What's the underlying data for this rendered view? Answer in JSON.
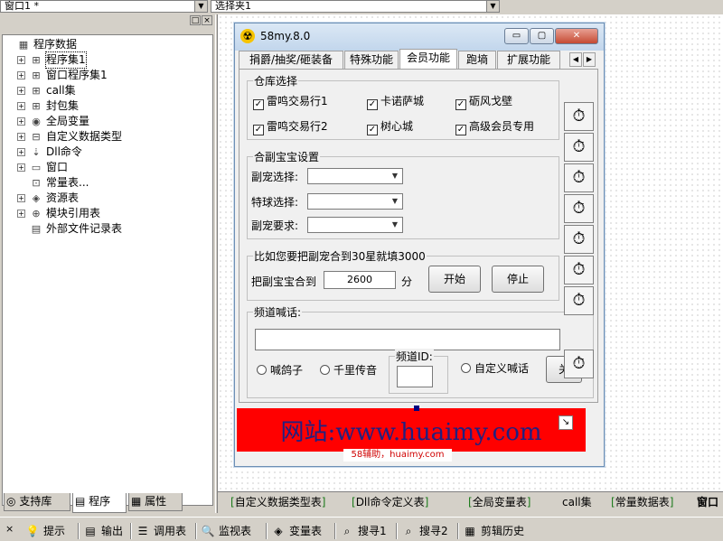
{
  "top": {
    "combo_left": "窗口1 *",
    "combo_right": "选择夹1"
  },
  "left": {
    "buttons": [
      "□",
      "×"
    ],
    "tree": [
      {
        "label": "程序数据",
        "icon": "▦",
        "icon_name": "database-icon"
      },
      {
        "label": "程序集1",
        "icon": "⊞",
        "icon_name": "module-icon",
        "expand": "+"
      },
      {
        "label": "窗口程序集1",
        "icon": "⊞",
        "icon_name": "module-icon",
        "expand": "+"
      },
      {
        "label": "call集",
        "icon": "⊞",
        "icon_name": "module-icon",
        "expand": "+"
      },
      {
        "label": "封包集",
        "icon": "⊞",
        "icon_name": "module-icon",
        "expand": "+"
      },
      {
        "label": "全局变量",
        "icon": "◉",
        "icon_name": "global-var-icon",
        "expand": "+"
      },
      {
        "label": "自定义数据类型",
        "icon": "⊟",
        "icon_name": "datatype-icon",
        "expand": "+"
      },
      {
        "label": "Dll命令",
        "icon": "⇣",
        "icon_name": "dll-icon",
        "expand": "+"
      },
      {
        "label": "窗口",
        "icon": "▭",
        "icon_name": "window-icon",
        "expand": "+"
      },
      {
        "label": "常量表...",
        "icon": "⊡",
        "icon_name": "constant-icon"
      },
      {
        "label": "资源表",
        "icon": "◈",
        "icon_name": "resource-icon",
        "expand": "+"
      },
      {
        "label": "模块引用表",
        "icon": "⊕",
        "icon_name": "module-ref-icon",
        "expand": "+"
      },
      {
        "label": "外部文件记录表",
        "icon": "▤",
        "icon_name": "file-record-icon"
      }
    ],
    "tabs": [
      {
        "label": "支持库",
        "icon": "◎"
      },
      {
        "label": "程序",
        "icon": "▤"
      },
      {
        "label": "属性",
        "icon": "▦"
      }
    ]
  },
  "form": {
    "title": "58my.8.0",
    "title_icon": "☢",
    "win_buttons": [
      "▭",
      "▢",
      "✕"
    ],
    "tabs": [
      "捐爵/抽奖/砸装备",
      "特殊功能",
      "会员功能",
      "跑墒",
      "扩展功能"
    ],
    "active_tab": 2,
    "warehouse": {
      "title": "仓库选择",
      "checks": [
        "雷鸣交易行1",
        "卡诺萨城",
        "砺风戈壁",
        "雷鸣交易行2",
        "树心城",
        "高级会员专用"
      ]
    },
    "pet": {
      "title": "合副宝宝设置",
      "rows": [
        "副宠选择:",
        "特球选择:",
        "副宠要求:"
      ]
    },
    "star": {
      "title": "比如您要把副宠合到30星就填3000",
      "label": "把副宝宝合到",
      "value": "2600",
      "unit": "分",
      "start": "开始",
      "stop": "停止"
    },
    "shout": {
      "title": "频道喊话:",
      "radio1": "喊鸽子",
      "radio2": "千里传音",
      "channel_label": "频道ID:",
      "radio3": "自定义喊话",
      "close": "关"
    },
    "timer_glyph": "⏱"
  },
  "banner": {
    "text": "网站:www.huaimy.com",
    "sub": "58辅助，huaimy.com"
  },
  "filetabs": [
    "自定义数据类型表",
    "Dll命令定义表",
    "全局变量表",
    "call集",
    "常量数据表",
    "窗口"
  ],
  "bottom": [
    {
      "label": "提示",
      "icon": "💡"
    },
    {
      "label": "输出",
      "icon": "▤"
    },
    {
      "label": "调用表",
      "icon": "☰"
    },
    {
      "label": "监视表",
      "icon": "🔍"
    },
    {
      "label": "变量表",
      "icon": "◈"
    },
    {
      "label": "搜寻1",
      "icon": "⌕"
    },
    {
      "label": "搜寻2",
      "icon": "⌕"
    },
    {
      "label": "剪辑历史",
      "icon": "▦"
    }
  ]
}
